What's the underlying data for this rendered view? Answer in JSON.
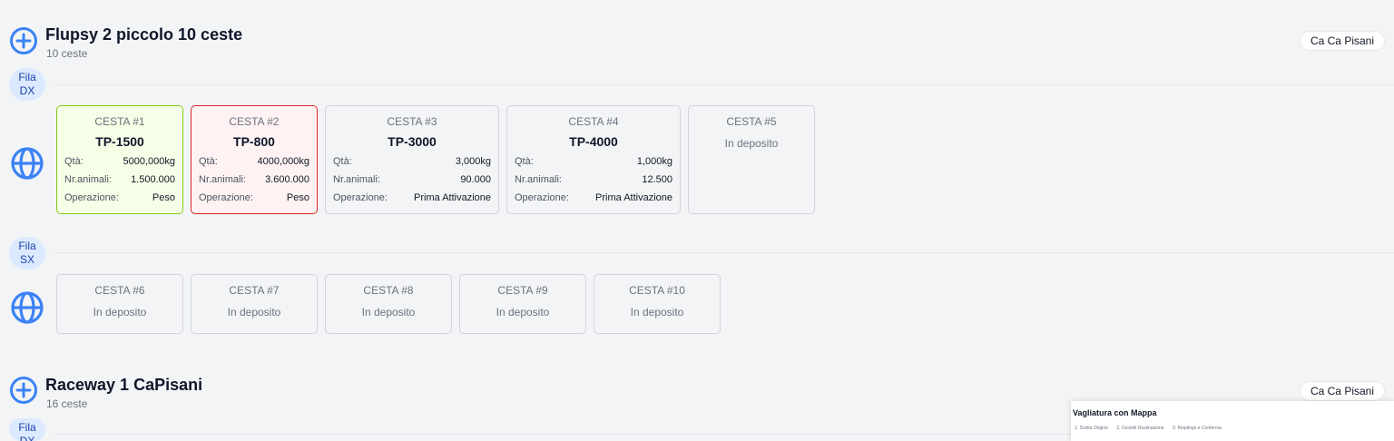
{
  "flupsy1": {
    "title": "Flupsy 2 piccolo 10 ceste",
    "subtitle": "10 ceste",
    "site": "Ca Ca Pisani",
    "row_dx": {
      "label_line1": "Fila",
      "label_line2": "DX"
    },
    "row_sx": {
      "label_line1": "Fila",
      "label_line2": "SX"
    },
    "baskets": [
      {
        "head": "CESTA #1",
        "code": "TP-1500",
        "qta_label": "Qtà:",
        "qta": "5000,000kg",
        "animali_label": "Nr.animali:",
        "animali": "1.500.000",
        "op_label": "Operazione:",
        "op": "Peso",
        "state": "green"
      },
      {
        "head": "CESTA #2",
        "code": "TP-800",
        "qta_label": "Qtà:",
        "qta": "4000,000kg",
        "animali_label": "Nr.animali:",
        "animali": "3.600.000",
        "op_label": "Operazione:",
        "op": "Peso",
        "state": "red"
      },
      {
        "head": "CESTA #3",
        "code": "TP-3000",
        "qta_label": "Qtà:",
        "qta": "3,000kg",
        "animali_label": "Nr.animali:",
        "animali": "90.000",
        "op_label": "Operazione:",
        "op": "Prima Attivazione",
        "state": "wide"
      },
      {
        "head": "CESTA #4",
        "code": "TP-4000",
        "qta_label": "Qtà:",
        "qta": "1,000kg",
        "animali_label": "Nr.animali:",
        "animali": "12.500",
        "op_label": "Operazione:",
        "op": "Prima Attivazione",
        "state": "wide"
      },
      {
        "head": "CESTA #5",
        "status": "In deposito"
      },
      {
        "head": "CESTA #6",
        "status": "In deposito"
      },
      {
        "head": "CESTA #7",
        "status": "In deposito"
      },
      {
        "head": "CESTA #8",
        "status": "In deposito"
      },
      {
        "head": "CESTA #9",
        "status": "In deposito"
      },
      {
        "head": "CESTA #10",
        "status": "In deposito"
      }
    ]
  },
  "raceway": {
    "title": "Raceway 1 CaPisani",
    "subtitle": "16 ceste",
    "site": "Ca Ca Pisani",
    "row_dx": {
      "label_line1": "Fila",
      "label_line2": "DX"
    }
  },
  "popup": {
    "title": "Vagliatura con Mappa",
    "steps": [
      "1. Scelta Origine",
      "2. Cestelli Destinazione",
      "3. Riepilogo e Conferma"
    ]
  },
  "colors": {
    "accent": "#3b82f6",
    "green_border": "#84cc16",
    "red_border": "#dc2626"
  },
  "icons": {
    "add": "plus-circle-icon",
    "map": "globe-icon"
  }
}
